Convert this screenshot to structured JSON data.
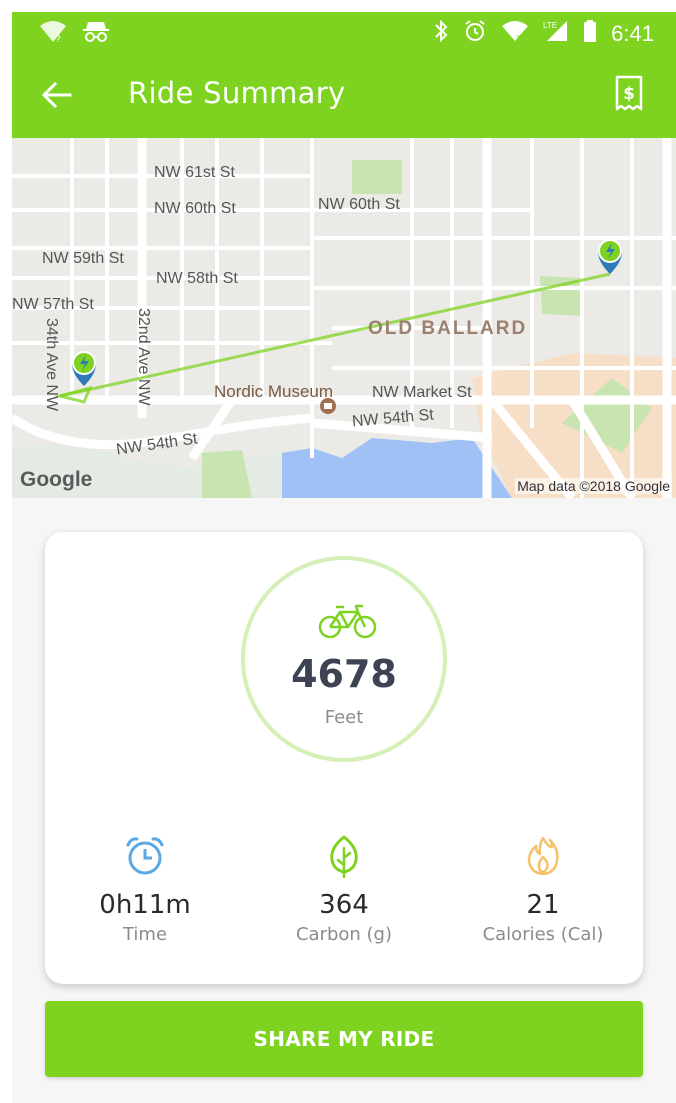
{
  "status_bar": {
    "time": "6:41",
    "icons": [
      "wifi-question-icon",
      "incognito-icon",
      "bluetooth-icon",
      "alarm-icon",
      "wifi-x-icon",
      "lte-signal-icon",
      "battery-icon"
    ]
  },
  "app_bar": {
    "title": "Ride Summary",
    "back_icon": "arrow-left-icon",
    "receipt_icon": "receipt-dollar-icon"
  },
  "map": {
    "streets": [
      "NW 61st St",
      "NW 60th St",
      "NW 60th St",
      "NW 59th St",
      "NW 58th St",
      "NW 57th St",
      "34th Ave NW",
      "32nd Ave NW",
      "NW Market St",
      "NW 54th St",
      "NW 54th St"
    ],
    "district": "OLD BALLARD",
    "poi": "Nordic Museum",
    "logo": "Google",
    "attribution": "Map data ©2018 Google",
    "route_color": "#7ed321"
  },
  "summary": {
    "distance_value": "4678",
    "distance_unit": "Feet",
    "stats": [
      {
        "icon": "alarm-clock-icon",
        "value": "0h11m",
        "label": "Time",
        "color": "#5aa8e6"
      },
      {
        "icon": "leaf-icon",
        "value": "364",
        "label": "Carbon (g)",
        "color": "#7ed321"
      },
      {
        "icon": "flame-icon",
        "value": "21",
        "label": "Calories (Cal)",
        "color": "#f5c26b"
      }
    ]
  },
  "share_button": {
    "label": "SHARE MY RIDE"
  },
  "colors": {
    "brand": "#7ed321",
    "ring": "#d4f0b7",
    "text_dark": "#3d4352"
  }
}
